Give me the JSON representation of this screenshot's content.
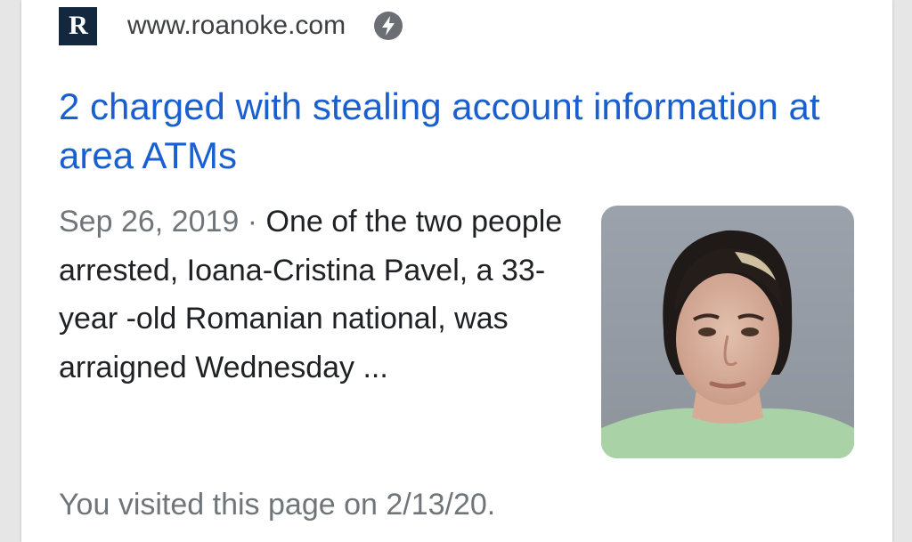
{
  "source": {
    "logo_letter": "R",
    "url": "www.roanoke.com",
    "amp_icon": "lightning-bolt-icon"
  },
  "result": {
    "title": "2 charged with stealing account information at area ATMs",
    "date": "Sep 26, 2019",
    "separator": " · ",
    "snippet": "One of the two people arrested, Ioana-Cristina Pavel, a 33-year -old Romanian national, was arraigned Wednesday ...",
    "thumbnail": "mugshot-photo"
  },
  "visited_note": "You visited this page on 2/13/20."
}
